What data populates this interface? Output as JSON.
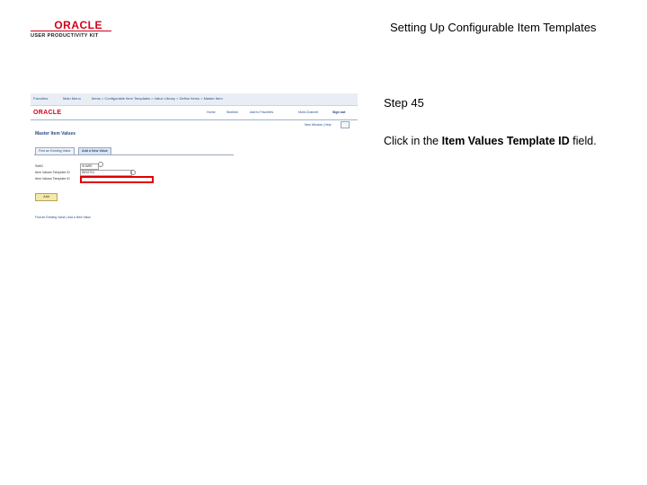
{
  "header": {
    "logo_oracle": "ORACLE",
    "logo_upk": "USER PRODUCTIVITY KIT",
    "doc_title": "Setting Up Configurable Item Templates"
  },
  "step": {
    "number": "Step 45",
    "instruction_prefix": "Click in the ",
    "instruction_bold": "Item Values Template ID",
    "instruction_suffix": " field."
  },
  "screenshot": {
    "breadcrumbs": [
      "Favorites",
      "Main Menu",
      "Items > Configurable Item Templates > Value Library > Define Items > Master Item"
    ],
    "logo": "ORACLE",
    "nav": [
      "Home",
      "Worklist",
      "Add to Favorites",
      "Multi-Channel",
      "Sign out"
    ],
    "new_window": "New Window | Help",
    "page_heading": "Master Item Values",
    "tabs": [
      "Find an Existing Value",
      "Add a New Value"
    ],
    "fields": [
      {
        "label": "SetID",
        "value": "SHARE"
      },
      {
        "label": "Item Values Template ID",
        "value": "WDGT01"
      },
      {
        "label": "Item Values Template ID",
        "value": ""
      }
    ],
    "add_button": "Add",
    "footer_links": "Find an Existing Value | Add a New Value"
  }
}
